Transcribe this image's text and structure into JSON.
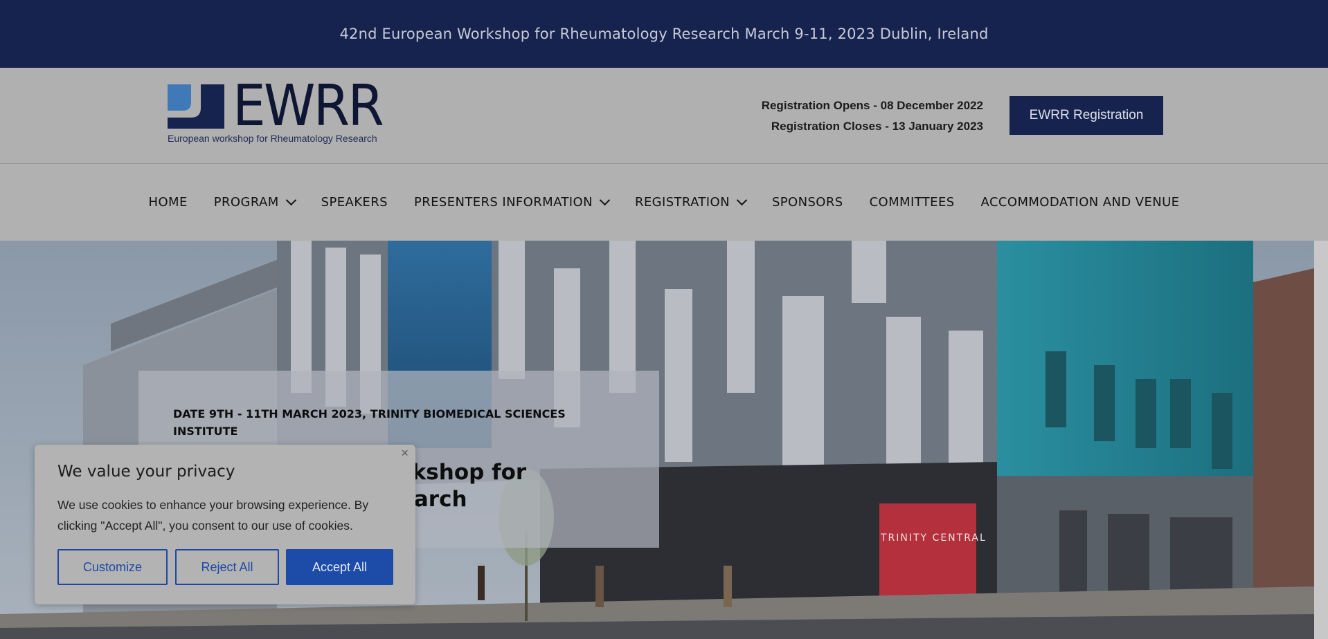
{
  "announcement": "42nd European Workshop for Rheumatology Research March 9-11, 2023 Dublin, Ireland",
  "logo": {
    "wordmark": "EWRR",
    "tagline": "European workshop for Rheumatology Research"
  },
  "registration": {
    "opens": "Registration Opens - 08 December 2022",
    "closes": "Registration Closes - 13 January 2023",
    "button_label": "EWRR Registration"
  },
  "nav": {
    "items": [
      {
        "label": "HOME",
        "dropdown": false
      },
      {
        "label": "PROGRAM",
        "dropdown": true
      },
      {
        "label": "SPEAKERS",
        "dropdown": false
      },
      {
        "label": "PRESENTERS INFORMATION",
        "dropdown": true
      },
      {
        "label": "REGISTRATION",
        "dropdown": true
      },
      {
        "label": "SPONSORS",
        "dropdown": false
      },
      {
        "label": "COMMITTEES",
        "dropdown": false
      },
      {
        "label": "ACCOMMODATION AND VENUE",
        "dropdown": false
      }
    ]
  },
  "hero": {
    "date_line": "DATE 9TH - 11TH MARCH 2023, TRINITY BIOMEDICAL SCIENCES INSTITUTE",
    "title": "42nd European Workshop for Rheumatology Research",
    "sign_text": "TRINITY CENTRAL"
  },
  "cookie": {
    "close": "×",
    "title": "We value your privacy",
    "text": "We use cookies to enhance your browsing experience. By clicking \"Accept All\", you consent to our use of cookies.",
    "customize": "Customize",
    "reject": "Reject All",
    "accept": "Accept All"
  },
  "colors": {
    "navy": "#17234f",
    "logo_blue": "#3f79b8",
    "cookie_blue": "#1c4ba8",
    "overlay_grey": "#b0b0b0"
  }
}
